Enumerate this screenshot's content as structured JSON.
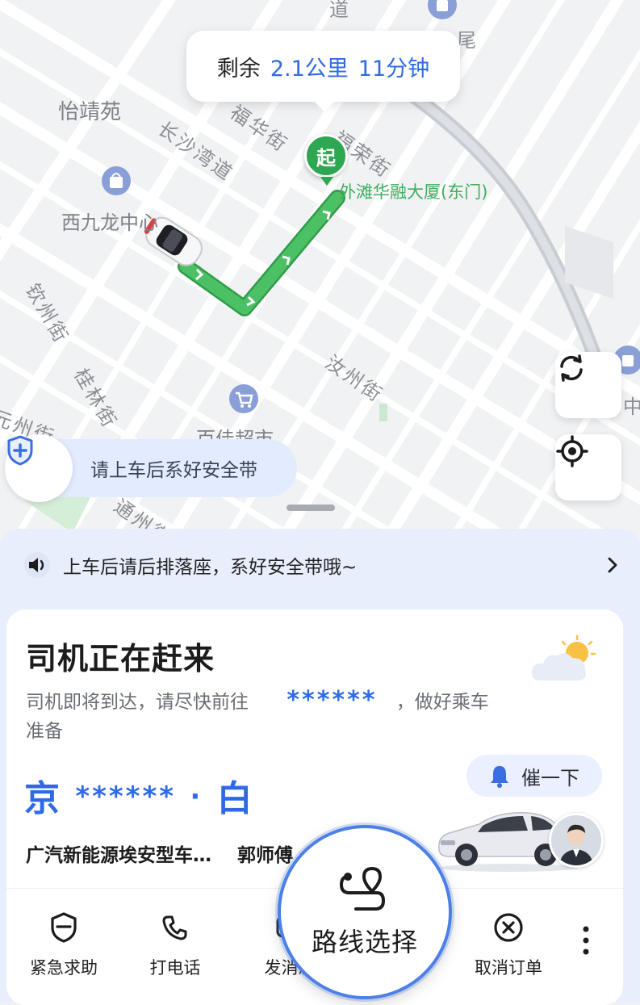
{
  "map": {
    "eta": {
      "prefix": "剩余",
      "distance": "2.1公里",
      "duration": "11分钟"
    },
    "pickup_marker": "起",
    "pickup_name": "外滩华融大厦(东门)",
    "labels": {
      "yijing_yuan": "怡靖苑",
      "xijiulong": "西九龙中心",
      "baijia": "百佳超市",
      "changsha_wan": "长沙湾道",
      "fuhua": "福华街",
      "fulai": "福荣街",
      "qinzhou": "钦州街",
      "guilin": "桂林街",
      "ruzhou": "汝州街",
      "tongzhou": "通州街",
      "partial_top": "道",
      "partial_top2": "尾",
      "partial_left": "元州街",
      "partial_right": "中"
    },
    "safety_tip": "请上车后系好安全带",
    "colors": {
      "route": "#3fb657",
      "accent": "#2f6ae4",
      "pin": "#2ea652"
    }
  },
  "sheet": {
    "notice": "上车后请后排落座，系好安全带哦~",
    "title": "司机正在赶来",
    "subtitle_before": "司机即将到达，请尽快前往",
    "subtitle_masked": "******",
    "subtitle_after": "，做好乘车准备",
    "plate_prefix": "京",
    "plate_masked": "******",
    "plate_sep": "·",
    "plate_color": "白",
    "hurry_label": "催一下",
    "car_model": "广汽新能源埃安型车…",
    "driver": "郭师傅",
    "actions": [
      {
        "label": "紧急求助",
        "icon": "shield-emergency-icon"
      },
      {
        "label": "打电话",
        "icon": "phone-icon"
      },
      {
        "label": "发消息",
        "icon": "message-icon"
      },
      {
        "label": "取消订单",
        "icon": "cancel-circle-icon"
      }
    ],
    "route_select": "路线选择"
  }
}
